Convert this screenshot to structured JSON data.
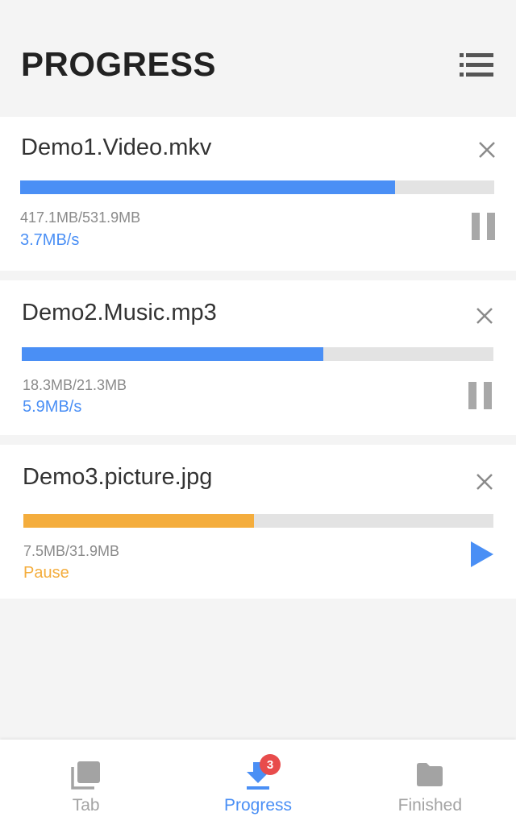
{
  "header": {
    "title": "PROGRESS",
    "menu_icon": "list-icon"
  },
  "colors": {
    "accent_blue": "#4a8ff5",
    "paused_orange": "#f4ad3d",
    "badge_red": "#e84c4c",
    "inactive_gray": "#a3a3a3"
  },
  "downloads": [
    {
      "name": "Demo1.Video.mkv",
      "size": "417.1MB/531.9MB",
      "status": "3.7MB/s",
      "state": "downloading",
      "progress_percent": 79,
      "action_icon": "pause-icon"
    },
    {
      "name": "Demo2.Music.mp3",
      "size": "18.3MB/21.3MB",
      "status": "5.9MB/s",
      "state": "downloading",
      "progress_percent": 64,
      "action_icon": "pause-icon"
    },
    {
      "name": "Demo3.picture.jpg",
      "size": "7.5MB/31.9MB",
      "status": "Pause",
      "state": "paused",
      "progress_percent": 49,
      "action_icon": "play-icon"
    }
  ],
  "bottom_nav": {
    "items": [
      {
        "label": "Tab",
        "icon": "tabs-icon",
        "active": false
      },
      {
        "label": "Progress",
        "icon": "download-icon",
        "active": true,
        "badge": "3"
      },
      {
        "label": "Finished",
        "icon": "folder-icon",
        "active": false
      }
    ]
  }
}
